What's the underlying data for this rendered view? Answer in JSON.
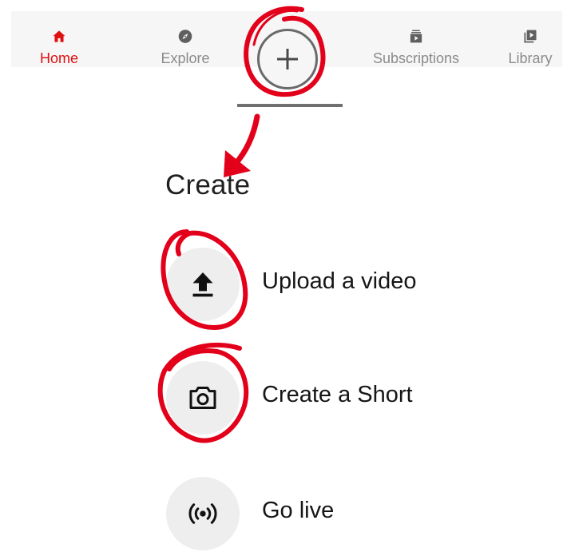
{
  "nav": {
    "home_label": "Home",
    "explore_label": "Explore",
    "subscriptions_label": "Subscriptions",
    "library_label": "Library"
  },
  "menu": {
    "title": "Create",
    "items": [
      {
        "label": "Upload a video",
        "icon": "upload-icon"
      },
      {
        "label": "Create a Short",
        "icon": "camera-icon"
      },
      {
        "label": "Go live",
        "icon": "live-broadcast-icon"
      }
    ]
  },
  "colors": {
    "accent": "#e01010",
    "nav_inactive": "#8b8b8b",
    "icon_dark": "#5f5f5f",
    "circle_bg": "#eeeeee",
    "annotation": "#e3001b"
  }
}
